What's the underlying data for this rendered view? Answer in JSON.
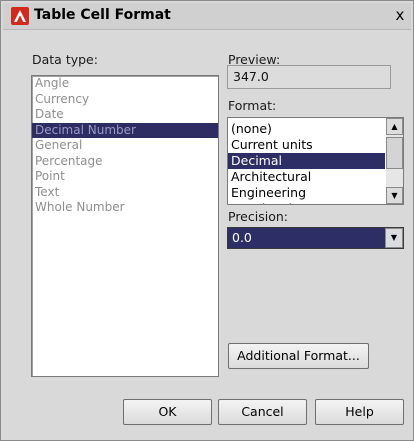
{
  "window": {
    "title": "Table Cell Format",
    "close_label": "x"
  },
  "data_type": {
    "label": "Data type:",
    "items": [
      "Angle",
      "Currency",
      "Date",
      "Decimal Number",
      "General",
      "Percentage",
      "Point",
      "Text",
      "Whole Number"
    ],
    "selected": "Decimal Number"
  },
  "preview": {
    "label": "Preview:",
    "value": "347.0"
  },
  "format": {
    "label": "Format:",
    "items": [
      "(none)",
      "Current units",
      "Decimal",
      "Architectural",
      "Engineering",
      "Fractional"
    ],
    "selected": "Decimal"
  },
  "precision": {
    "label": "Precision:",
    "value": "0.0"
  },
  "buttons": {
    "additional_format": "Additional Format...",
    "ok": "OK",
    "cancel": "Cancel",
    "help": "Help"
  },
  "colors": {
    "selection": "#2e2e66",
    "app_icon": "#d42a1e"
  },
  "icons": {
    "app": "autocad-logo-icon",
    "close": "close-icon",
    "scroll_up": "arrow-up-icon",
    "scroll_down": "arrow-down-icon",
    "dropdown": "chevron-down-icon"
  }
}
